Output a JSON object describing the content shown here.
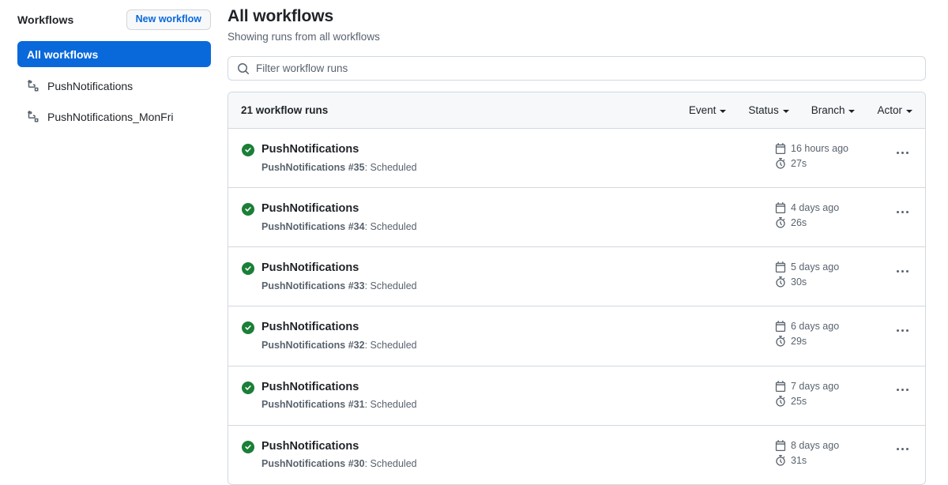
{
  "sidebar": {
    "title": "Workflows",
    "new_workflow_label": "New workflow",
    "items": [
      {
        "label": "All workflows",
        "icon": "none",
        "selected": true
      },
      {
        "label": "PushNotifications",
        "icon": "workflow-icon",
        "selected": false
      },
      {
        "label": "PushNotifications_MonFri",
        "icon": "workflow-icon",
        "selected": false
      }
    ]
  },
  "main": {
    "title": "All workflows",
    "subtitle": "Showing runs from all workflows",
    "search": {
      "placeholder": "Filter workflow runs",
      "value": "",
      "icon": "search-icon"
    },
    "runs_header": {
      "count_label": "21 workflow runs",
      "filters": [
        {
          "label": "Event"
        },
        {
          "label": "Status"
        },
        {
          "label": "Branch"
        },
        {
          "label": "Actor"
        }
      ]
    },
    "runs": [
      {
        "status": "success",
        "name": "PushNotifications",
        "workflow": "PushNotifications",
        "run_number": "#35",
        "trigger": "Scheduled",
        "subtitle": "PushNotifications #35: Scheduled",
        "time_ago": "16 hours ago",
        "duration": "27s"
      },
      {
        "status": "success",
        "name": "PushNotifications",
        "workflow": "PushNotifications",
        "run_number": "#34",
        "trigger": "Scheduled",
        "subtitle": "PushNotifications #34: Scheduled",
        "time_ago": "4 days ago",
        "duration": "26s"
      },
      {
        "status": "success",
        "name": "PushNotifications",
        "workflow": "PushNotifications",
        "run_number": "#33",
        "trigger": "Scheduled",
        "subtitle": "PushNotifications #33: Scheduled",
        "time_ago": "5 days ago",
        "duration": "30s"
      },
      {
        "status": "success",
        "name": "PushNotifications",
        "workflow": "PushNotifications",
        "run_number": "#32",
        "trigger": "Scheduled",
        "subtitle": "PushNotifications #32: Scheduled",
        "time_ago": "6 days ago",
        "duration": "29s"
      },
      {
        "status": "success",
        "name": "PushNotifications",
        "workflow": "PushNotifications",
        "run_number": "#31",
        "trigger": "Scheduled",
        "subtitle": "PushNotifications #31: Scheduled",
        "time_ago": "7 days ago",
        "duration": "25s"
      },
      {
        "status": "success",
        "name": "PushNotifications",
        "workflow": "PushNotifications",
        "run_number": "#30",
        "trigger": "Scheduled",
        "subtitle": "PushNotifications #30: Scheduled",
        "time_ago": "8 days ago",
        "duration": "31s"
      }
    ]
  },
  "colors": {
    "accent": "#0969da",
    "success": "#1a7f37",
    "border": "#d1d9e0",
    "muted_text": "#59636e",
    "header_bg": "#f6f8fa"
  }
}
